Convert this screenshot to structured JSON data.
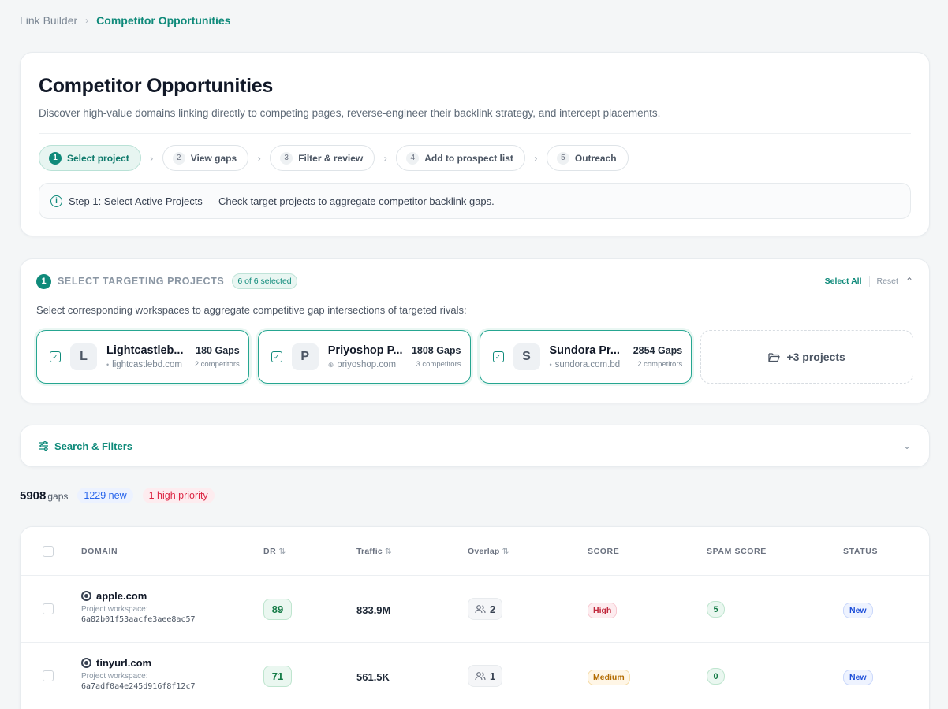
{
  "breadcrumb": {
    "parent": "Link Builder",
    "current": "Competitor Opportunities"
  },
  "hero": {
    "title": "Competitor Opportunities",
    "subtitle": "Discover high-value domains linking directly to competing pages, reverse-engineer their backlink strategy, and intercept placements.",
    "steps": [
      {
        "num": "1",
        "label": "Select project",
        "active": true
      },
      {
        "num": "2",
        "label": "View gaps",
        "active": false
      },
      {
        "num": "3",
        "label": "Filter & review",
        "active": false
      },
      {
        "num": "4",
        "label": "Add to prospect list",
        "active": false
      },
      {
        "num": "5",
        "label": "Outreach",
        "active": false
      }
    ],
    "info": "Step 1: Select Active Projects — Check target projects to aggregate competitor backlink gaps."
  },
  "targeting": {
    "badge": "1",
    "title": "SELECT TARGETING PROJECTS",
    "count": "6 of 6 selected",
    "select_all": "Select All",
    "reset": "Reset",
    "description": "Select corresponding workspaces to aggregate competitive gap intersections of targeted rivals:",
    "projects": [
      {
        "initial": "L",
        "name": "Lightcastleb...",
        "domain": "lightcastlebd.com",
        "gaps": "180 Gaps",
        "competitors": "2 competitors"
      },
      {
        "initial": "P",
        "name": "Priyoshop P...",
        "domain": "priyoshop.com",
        "gaps": "1808 Gaps",
        "competitors": "3 competitors"
      },
      {
        "initial": "S",
        "name": "Sundora Pr...",
        "domain": "sundora.com.bd",
        "gaps": "2854 Gaps",
        "competitors": "2 competitors"
      }
    ],
    "more": "+3 projects"
  },
  "filters": {
    "label": "Search & Filters"
  },
  "summary": {
    "total": "5908",
    "total_unit": "gaps",
    "new": "1229 new",
    "high": "1 high priority"
  },
  "table": {
    "headers": {
      "domain": "DOMAIN",
      "dr": "DR",
      "traffic": "Traffic",
      "overlap": "Overlap",
      "score": "SCORE",
      "spam": "SPAM SCORE",
      "status": "STATUS"
    },
    "rows": [
      {
        "domain": "apple.com",
        "ws_label": "Project workspace:",
        "ws_id": "6a82b01f53aacfe3aee8ac57",
        "dr": "89",
        "traffic": "833.9M",
        "overlap": "2",
        "score": "High",
        "spam": "5",
        "status": "New"
      },
      {
        "domain": "tinyurl.com",
        "ws_label": "Project workspace:",
        "ws_id": "6a7adf0a4e245d916f8f12c7",
        "dr": "71",
        "traffic": "561.5K",
        "overlap": "1",
        "score": "Medium",
        "spam": "0",
        "status": "New"
      }
    ]
  },
  "colors": {
    "accent": "#0f8a7a",
    "new": "#2563eb",
    "high": "#dc2644"
  }
}
